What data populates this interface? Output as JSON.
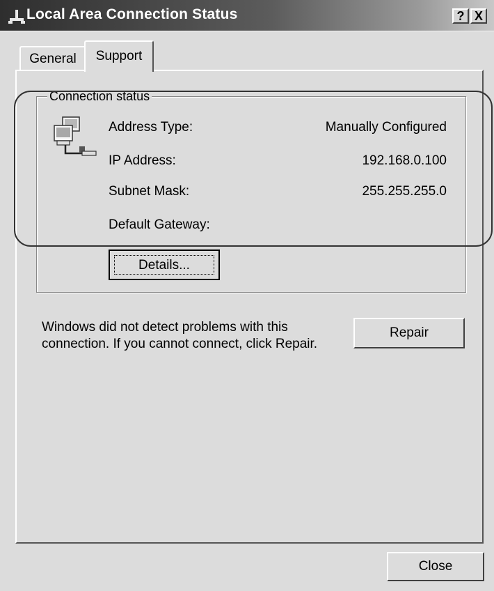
{
  "window": {
    "title": "Local Area Connection Status",
    "help_button": "?",
    "close_button": "X"
  },
  "tabs": [
    {
      "label": "General",
      "selected": false
    },
    {
      "label": "Support",
      "selected": true
    }
  ],
  "connection_status": {
    "legend": "Connection status",
    "rows": [
      {
        "label": "Address Type:",
        "value": "Manually Configured"
      },
      {
        "label": "IP Address:",
        "value": "192.168.0.100"
      },
      {
        "label": "Subnet Mask:",
        "value": "255.255.255.0"
      },
      {
        "label": "Default Gateway:",
        "value": ""
      }
    ],
    "details_button": "Details..."
  },
  "message": "Windows did not detect problems with this connection. If you cannot connect, click Repair.",
  "repair_button": "Repair",
  "close_button": "Close",
  "icons": {
    "title_icon": "network-connection-icon",
    "group_icon": "network-computers-icon"
  }
}
